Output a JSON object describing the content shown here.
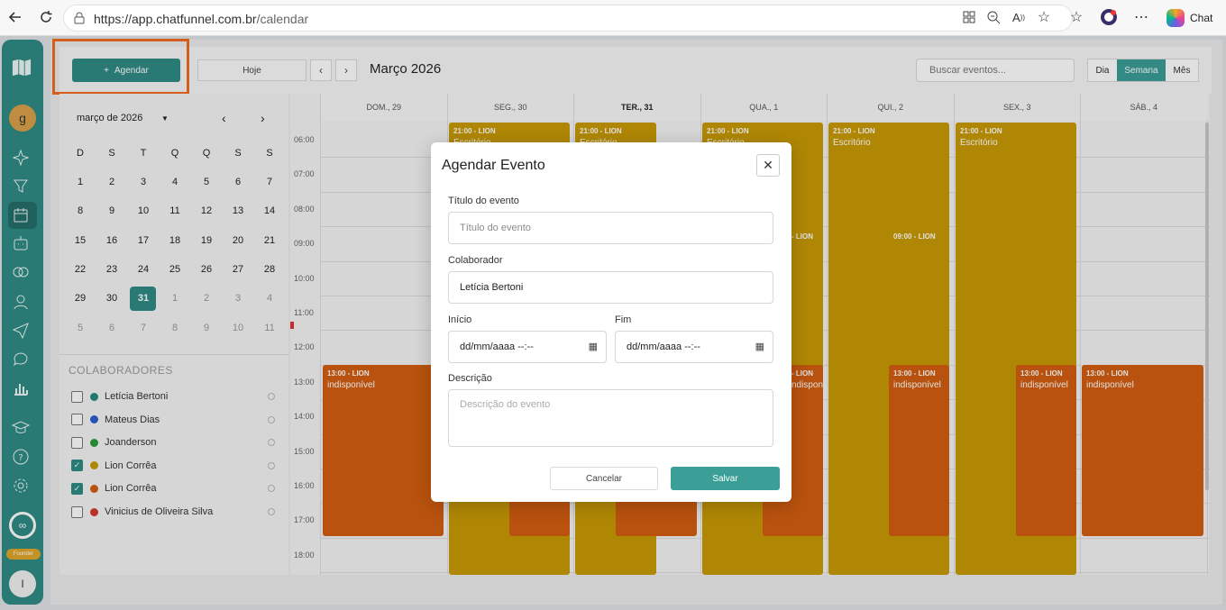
{
  "browser": {
    "url_base": "https://app.chatfunnel.com.br",
    "url_path": "/calendar",
    "chat_label": "Chat"
  },
  "toolbar": {
    "agendar_label": "Agendar",
    "today_label": "Hoje",
    "month_title": "Março 2026",
    "search_placeholder": "Buscar eventos...",
    "views": [
      "Dia",
      "Semana",
      "Mês"
    ],
    "active_view": "Semana"
  },
  "rail": {
    "user_initial": "g",
    "bottom_initial": "I",
    "founder_label": "Founder"
  },
  "mini_calendar": {
    "title": "março de 2026",
    "weekdays": [
      "D",
      "S",
      "T",
      "Q",
      "Q",
      "S",
      "S"
    ],
    "weeks": [
      [
        "1",
        "2",
        "3",
        "4",
        "5",
        "6",
        "7"
      ],
      [
        "8",
        "9",
        "10",
        "11",
        "12",
        "13",
        "14"
      ],
      [
        "15",
        "16",
        "17",
        "18",
        "19",
        "20",
        "21"
      ],
      [
        "22",
        "23",
        "24",
        "25",
        "26",
        "27",
        "28"
      ],
      [
        "29",
        "30",
        "31",
        "1",
        "2",
        "3",
        "4"
      ],
      [
        "5",
        "6",
        "7",
        "8",
        "9",
        "10",
        "11"
      ]
    ],
    "today": "31"
  },
  "collaborators": {
    "heading": "COLABORADORES",
    "items": [
      {
        "name": "Letícia Bertoni",
        "color": "#2a8a7e",
        "checked": false
      },
      {
        "name": "Mateus Dias",
        "color": "#2c5fcc",
        "checked": false
      },
      {
        "name": "Joanderson",
        "color": "#2a9a3a",
        "checked": false
      },
      {
        "name": "Lion Corrêa",
        "color": "#c99a06",
        "checked": true
      },
      {
        "name": "Lion Corrêa",
        "color": "#d35e10",
        "checked": true
      },
      {
        "name": "Vinicius de Oliveira Silva",
        "color": "#d33a2a",
        "checked": false
      }
    ]
  },
  "week": {
    "days": [
      "DOM., 29",
      "SEG., 30",
      "TER., 31",
      "QUA., 1",
      "QUI., 2",
      "SEX., 3",
      "SÁB., 4"
    ],
    "hours": [
      "06:00",
      "07:00",
      "08:00",
      "09:00",
      "10:00",
      "11:00",
      "12:00",
      "13:00",
      "14:00",
      "15:00",
      "16:00",
      "17:00",
      "18:00"
    ],
    "event_texts": {
      "t2100": "21:00 - LION",
      "escritorio": "Escritório",
      "t0900": "09:00 - LION",
      "t0900b": "- LION",
      "t1300": "13:00 - LION",
      "t1300b": "- LION",
      "indisponivel": "indisponível",
      "indisponivel_b": "ndisponível"
    }
  },
  "modal": {
    "title": "Agendar Evento",
    "title_label": "Título do evento",
    "title_placeholder": "Título do evento",
    "colab_label": "Colaborador",
    "colab_value": "Letícia Bertoni",
    "start_label": "Início",
    "end_label": "Fim",
    "date_placeholder": "dd/mm/aaaa --:--",
    "desc_label": "Descrição",
    "desc_placeholder": "Descrição do evento",
    "cancel_label": "Cancelar",
    "save_label": "Salvar"
  }
}
